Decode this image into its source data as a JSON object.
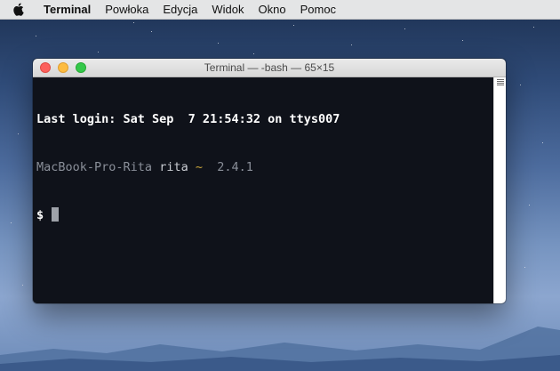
{
  "menubar": {
    "app_name": "Terminal",
    "items": [
      "Powłoka",
      "Edycja",
      "Widok",
      "Okno",
      "Pomoc"
    ]
  },
  "window": {
    "title": "Terminal — -bash — 65×15"
  },
  "terminal": {
    "last_login": "Last login: Sat Sep  7 21:54:32 on ttys007",
    "prompt_host": "MacBook-Pro-Rita",
    "prompt_user": "rita",
    "prompt_dir": "~",
    "prompt_version": "2.4.1",
    "prompt_symbol": "$"
  },
  "colors": {
    "terminal_bg": "#0f121a",
    "tilde": "#c8a43a",
    "close": "#fc605c",
    "minimize": "#fdbc40",
    "maximize": "#34c84a"
  },
  "icons": [
    "apple-icon",
    "window-close-icon",
    "window-minimize-icon",
    "window-maximize-icon",
    "scrollbar-icon"
  ]
}
